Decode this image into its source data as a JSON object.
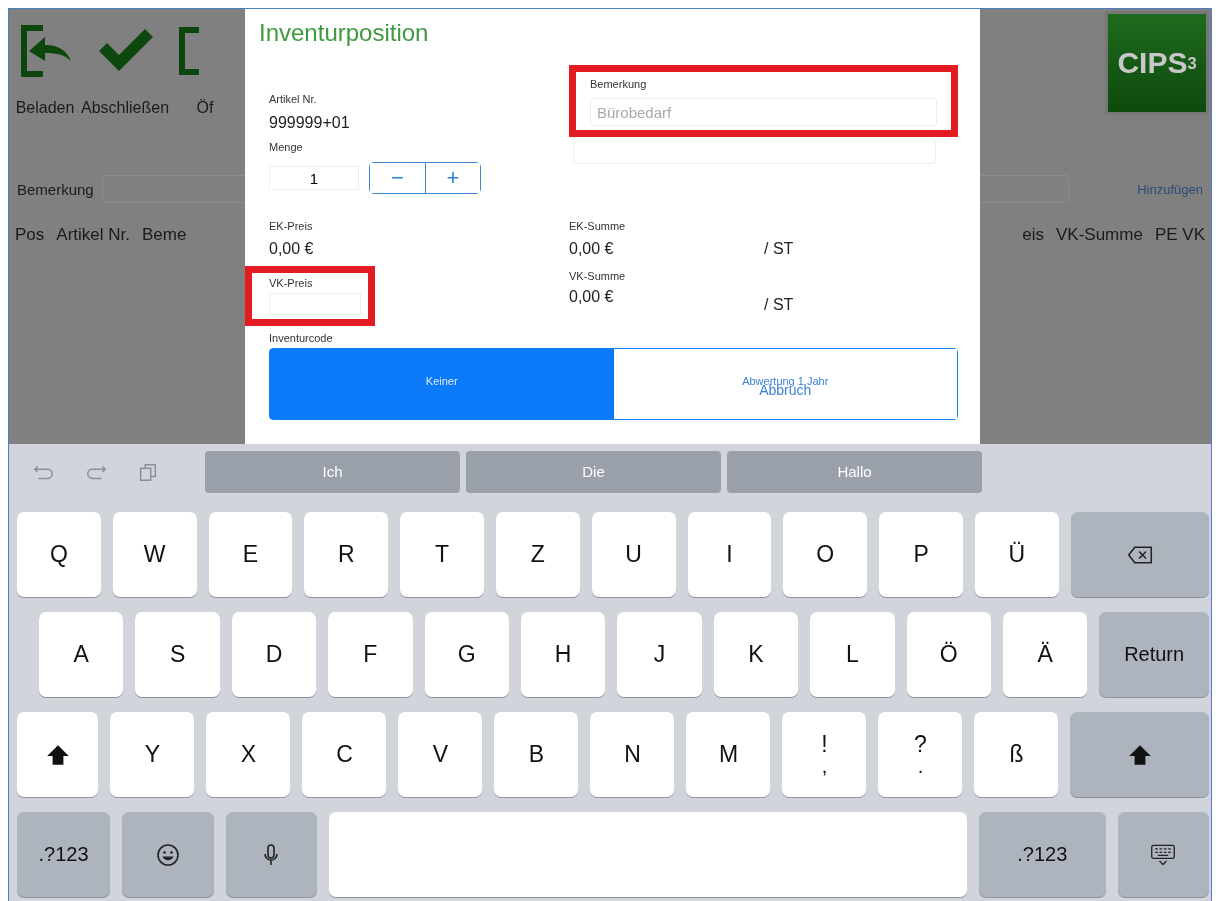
{
  "app": {
    "toolbar": [
      {
        "kind": "load",
        "label": "Beladen"
      },
      {
        "kind": "finish",
        "label": "Abschließen"
      },
      {
        "kind": "open",
        "label": "Öf"
      }
    ],
    "logo": "CIPS$^{3}$",
    "remark_label": "Bemerkung",
    "add_link": "Hinzufügen",
    "columns_left": [
      "Pos",
      "Artikel Nr.",
      "Beme"
    ],
    "columns_right": [
      "eis",
      "VK-Summe",
      "PE VK"
    ]
  },
  "dialog": {
    "title": "Inventurposition",
    "article": {
      "label": "Artikel Nr.",
      "value": "999999+01"
    },
    "quantity": {
      "label": "Menge",
      "value": "1",
      "minus": "−",
      "plus": "+"
    },
    "remark": {
      "label": "Bemerkung",
      "placeholder": "Bürobedarf",
      "highlighted": true
    },
    "ek_price": {
      "label": "EK-Preis",
      "value": "0,00 €"
    },
    "ek_sum": {
      "label": "EK-Summe",
      "value": "0,00 €",
      "unit": "/ ST"
    },
    "vk_price": {
      "label": "VK-Preis",
      "highlighted": true
    },
    "vk_sum": {
      "label": "VK-Summe",
      "value": "0,00 €",
      "unit": "/ ST"
    },
    "inventory_code": {
      "label": "Inventurcode",
      "options": [
        {
          "label": "Keiner",
          "selected": true
        },
        {
          "label": "Abwertung 1 Jahr",
          "selected": false
        }
      ]
    },
    "cancel_button": "Abbruch"
  },
  "keyboard": {
    "suggestions": [
      "Ich",
      "Die",
      "Hallo"
    ],
    "rows": [
      [
        {
          "kind": "letter",
          "label": "Q"
        },
        {
          "kind": "letter",
          "label": "W"
        },
        {
          "kind": "letter",
          "label": "E"
        },
        {
          "kind": "letter",
          "label": "R"
        },
        {
          "kind": "letter",
          "label": "T"
        },
        {
          "kind": "letter",
          "label": "Z"
        },
        {
          "kind": "letter",
          "label": "U"
        },
        {
          "kind": "letter",
          "label": "I"
        },
        {
          "kind": "letter",
          "label": "O"
        },
        {
          "kind": "letter",
          "label": "P"
        },
        {
          "kind": "letter",
          "label": "Ü"
        },
        {
          "kind": "delete"
        }
      ],
      [
        {
          "kind": "letter",
          "label": "A"
        },
        {
          "kind": "letter",
          "label": "S"
        },
        {
          "kind": "letter",
          "label": "D"
        },
        {
          "kind": "letter",
          "label": "F"
        },
        {
          "kind": "letter",
          "label": "G"
        },
        {
          "kind": "letter",
          "label": "H"
        },
        {
          "kind": "letter",
          "label": "J"
        },
        {
          "kind": "letter",
          "label": "K"
        },
        {
          "kind": "letter",
          "label": "L"
        },
        {
          "kind": "letter",
          "label": "Ö"
        },
        {
          "kind": "letter",
          "label": "Ä"
        },
        {
          "kind": "return",
          "label": "Return"
        }
      ],
      [
        {
          "kind": "shift"
        },
        {
          "kind": "letter",
          "label": "Y"
        },
        {
          "kind": "letter",
          "label": "X"
        },
        {
          "kind": "letter",
          "label": "C"
        },
        {
          "kind": "letter",
          "label": "V"
        },
        {
          "kind": "letter",
          "label": "B"
        },
        {
          "kind": "letter",
          "label": "N"
        },
        {
          "kind": "letter",
          "label": "M"
        },
        {
          "kind": "dual",
          "label": "!",
          "sub": ","
        },
        {
          "kind": "dual",
          "label": "?",
          "sub": "."
        },
        {
          "kind": "letter",
          "label": "ß"
        },
        {
          "kind": "shift-wide"
        }
      ],
      [
        {
          "kind": "mode",
          "label": ".?123"
        },
        {
          "kind": "emoji"
        },
        {
          "kind": "mic"
        },
        {
          "kind": "space"
        },
        {
          "kind": "mode-wide",
          "label": ".?123"
        },
        {
          "kind": "hide"
        }
      ]
    ]
  }
}
